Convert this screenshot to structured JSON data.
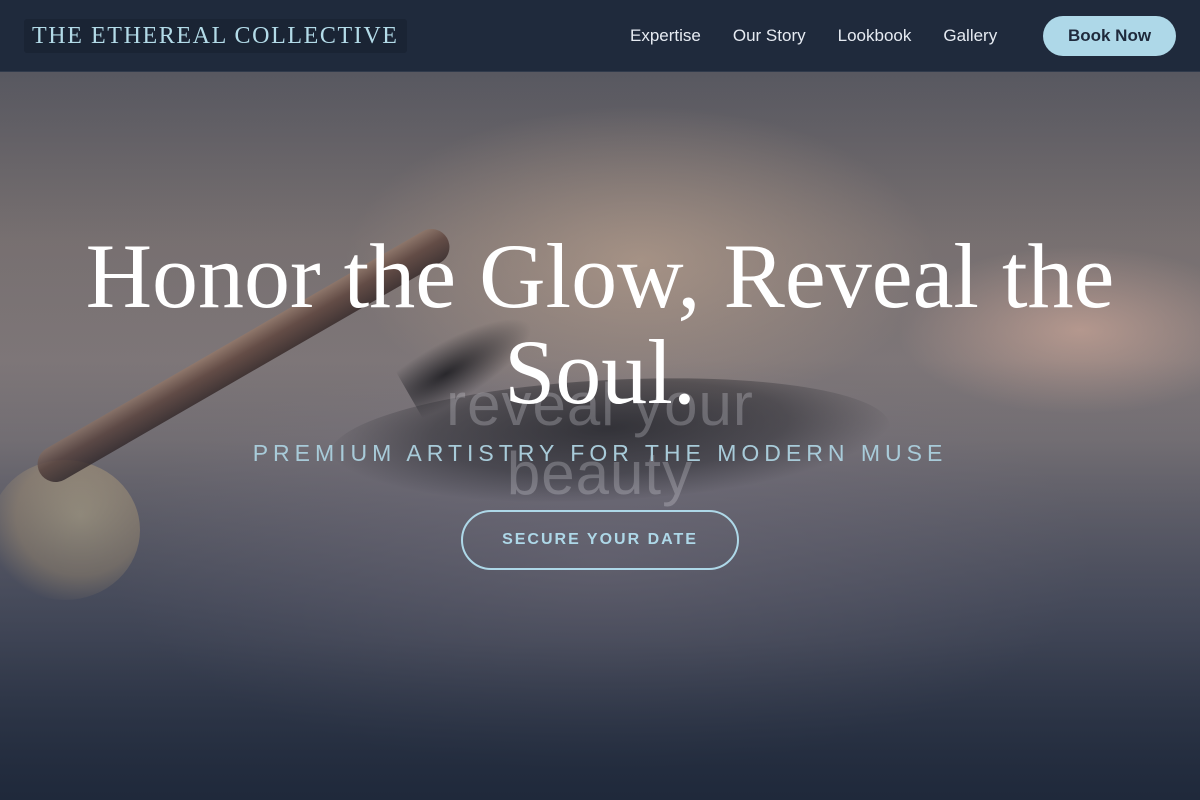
{
  "header": {
    "brand": "THE ETHEREAL COLLECTIVE",
    "nav": [
      {
        "label": "Expertise"
      },
      {
        "label": "Our Story"
      },
      {
        "label": "Lookbook"
      },
      {
        "label": "Gallery"
      }
    ],
    "book_button": "Book Now"
  },
  "hero": {
    "title": "Honor the Glow, Reveal the Soul.",
    "ghost_text": "reveal your beauty",
    "subtitle": "PREMIUM ARTISTRY FOR THE MODERN MUSE",
    "cta": "SECURE YOUR DATE"
  },
  "colors": {
    "header_bg": "#1f2a3c",
    "accent": "#aed8e8",
    "brand_text": "#b3dbe8",
    "subtitle": "#a8cbd9"
  }
}
